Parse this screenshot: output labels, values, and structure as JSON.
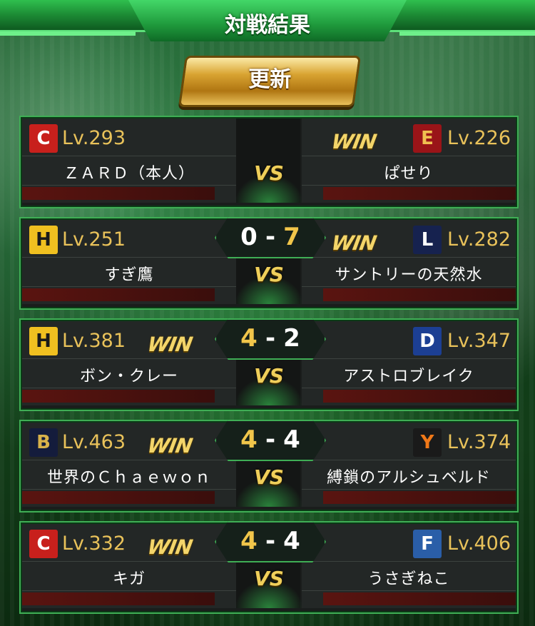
{
  "header": {
    "title": "対戦結果",
    "update_label": "更新"
  },
  "vs_label": "VS",
  "win_label": "WIN",
  "matches": [
    {
      "left": {
        "team_icon": "carp-logo-icon",
        "logo_text": "C",
        "logo_bg": "#c8201c",
        "logo_color": "#ffffff",
        "level": "Lv.293",
        "name": "ＺＡＲＤ（本人）"
      },
      "right": {
        "team_icon": "eagles-logo-icon",
        "logo_text": "E",
        "logo_bg": "#9a1418",
        "logo_color": "#f0c050",
        "level": "Lv.226",
        "name": "ぱせり"
      },
      "winner": "right",
      "score": null
    },
    {
      "left": {
        "team_icon": "hawks-logo-icon",
        "logo_text": "H",
        "logo_bg": "#f0c020",
        "logo_color": "#1a1a1a",
        "level": "Lv.251",
        "name": "すぎ鷹"
      },
      "right": {
        "team_icon": "lions-logo-icon",
        "logo_text": "L",
        "logo_bg": "#16224f",
        "logo_color": "#ffffff",
        "level": "Lv.282",
        "name": "サントリーの天然水"
      },
      "winner": "right",
      "score": {
        "left": "0",
        "right": "7",
        "separator": "-"
      }
    },
    {
      "left": {
        "team_icon": "hawks-logo-icon",
        "logo_text": "H",
        "logo_bg": "#f0c020",
        "logo_color": "#1a1a1a",
        "level": "Lv.381",
        "name": "ボン・クレー"
      },
      "right": {
        "team_icon": "dragons-logo-icon",
        "logo_text": "D",
        "logo_bg": "#1c3f93",
        "logo_color": "#ffffff",
        "level": "Lv.347",
        "name": "アストロブレイク"
      },
      "winner": "left",
      "score": {
        "left": "4",
        "right": "2",
        "separator": "-"
      }
    },
    {
      "left": {
        "team_icon": "buffaloes-logo-icon",
        "logo_text": "B",
        "logo_bg": "#141c3c",
        "logo_color": "#d9b24a",
        "level": "Lv.463",
        "name": "世界のＣｈａｅｗｏｎ"
      },
      "right": {
        "team_icon": "giants-logo-icon",
        "logo_text": "Y",
        "logo_bg": "#1a1a1a",
        "logo_color": "#f07818",
        "level": "Lv.374",
        "name": "縛鎖のアルシュベルド"
      },
      "winner": "left",
      "score": {
        "left": "4",
        "right": "4",
        "separator": "-"
      }
    },
    {
      "left": {
        "team_icon": "carp-logo-icon",
        "logo_text": "C",
        "logo_bg": "#c8201c",
        "logo_color": "#ffffff",
        "level": "Lv.332",
        "name": "キガ"
      },
      "right": {
        "team_icon": "fighters-logo-icon",
        "logo_text": "F",
        "logo_bg": "#2a5ea8",
        "logo_color": "#ffffff",
        "level": "Lv.406",
        "name": "うさぎねこ"
      },
      "winner": "left",
      "score": {
        "left": "4",
        "right": "4",
        "separator": "-"
      }
    }
  ]
}
